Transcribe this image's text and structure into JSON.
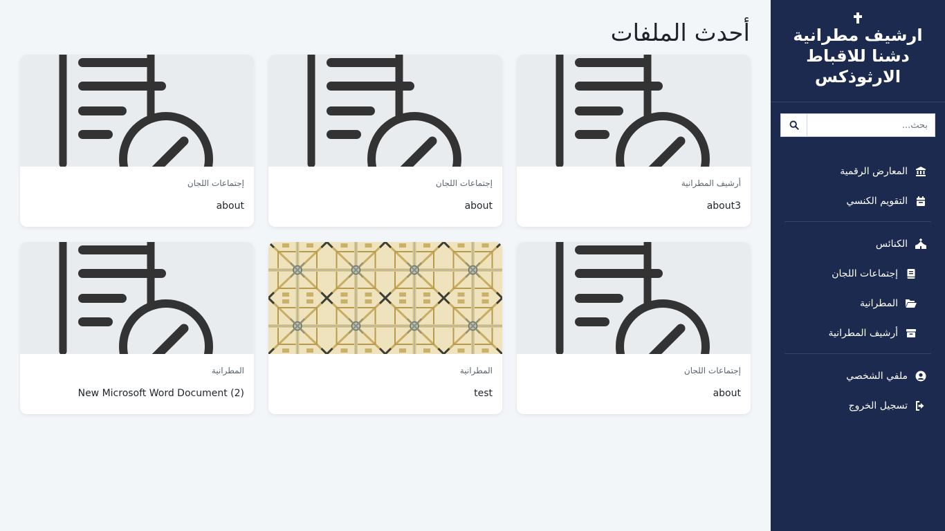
{
  "sidebar": {
    "brand_title": "ارشيف مطرانية دشنا للاقباط الارثوذكس",
    "search_placeholder": "بحث...",
    "nav": {
      "galleries": "المعارض الرقمية",
      "calendar": "التقويم الكنسي",
      "churches": "الكنائس",
      "committees": "إجتماعات اللجان",
      "diocese": "المطرانية",
      "diocese_archive": "أرشيف المطرانية",
      "profile": "ملفي الشخصي",
      "logout": "تسجيل الخروج"
    }
  },
  "main": {
    "title": "أحدث الملفات",
    "cards": [
      {
        "category": "أرشيف المطرانية",
        "name": "about3",
        "thumb": "document-icon"
      },
      {
        "category": "إجتماعات اللجان",
        "name": "about",
        "thumb": "document-icon"
      },
      {
        "category": "إجتماعات اللجان",
        "name": "about",
        "thumb": "document-icon"
      },
      {
        "category": "إجتماعات اللجان",
        "name": "about",
        "thumb": "document-icon"
      },
      {
        "category": "المطرانية",
        "name": "test",
        "thumb": "pattern-image"
      },
      {
        "category": "المطرانية",
        "name": "New Microsoft Word Document (2)",
        "thumb": "document-icon"
      }
    ]
  },
  "colors": {
    "sidebar_bg": "#1b2a4e",
    "page_bg": "#f3f6f9",
    "thumb_bg": "#e9ecef",
    "icon_dark": "#333333"
  }
}
